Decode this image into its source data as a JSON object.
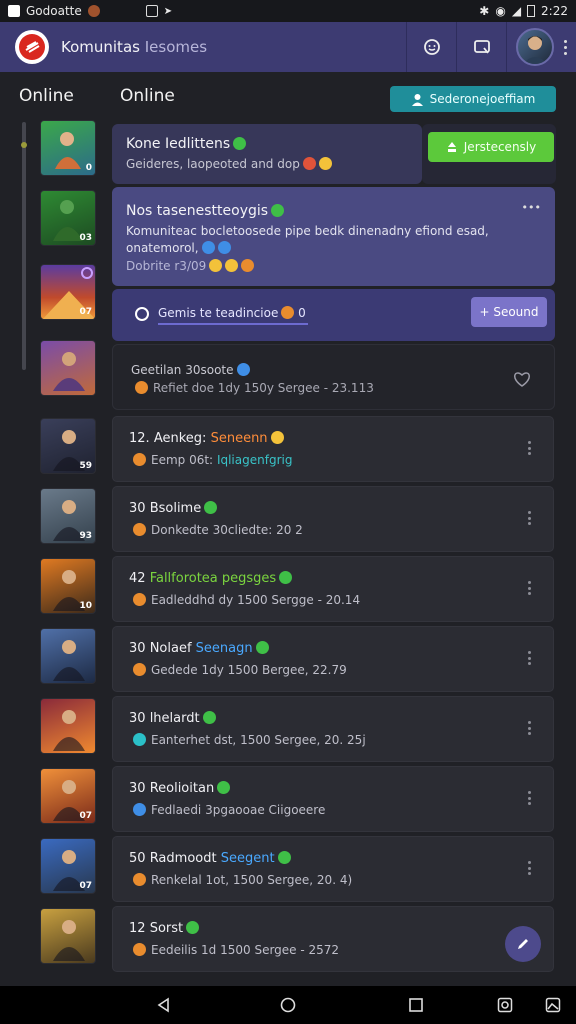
{
  "status_bar": {
    "app_name": "Godoatte",
    "time": "2:22"
  },
  "header": {
    "title": "Komunitas",
    "title_dim": "Iesomes"
  },
  "sections": {
    "left": "Online",
    "right": "Online"
  },
  "top_button": {
    "label": "Sederonejoeffiam"
  },
  "featured": [
    {
      "title": "Kone Iedlittens",
      "subtitle": "Geideres, laopeoted and dop",
      "action": "Jerstecensly"
    },
    {
      "title": "Nos tasenestteoygis",
      "body": "Komuniteac bocletoosede pipe bedk dinenadny efiond esad, onatemorol,",
      "meta": "Dobrite r3/09",
      "more": "•••"
    },
    {
      "input": "Gemis te teadincioe",
      "input_tail": "0",
      "button": "+ Seound"
    },
    {
      "title": "Geetilan 30soote",
      "subtitle": "Refiet doe 1dy 150y Sergee - 23.113"
    }
  ],
  "rows": [
    {
      "num": "12.",
      "name": "Aenkeg:",
      "highlight": "Seneenn",
      "highlight_color": "orange",
      "sub": "Eemp 06t:",
      "sub_highlight": "Iqliagenfgrig",
      "thumb_badge": "59"
    },
    {
      "num": "30",
      "name": "Bsolime",
      "highlight": "",
      "sub": "Donkedte 30cliedte: 20 2",
      "sub_highlight": "",
      "thumb_badge": "93"
    },
    {
      "num": "42",
      "name": "",
      "highlight": "Fallforotea pegsges",
      "highlight_color": "green",
      "sub": "Eadleddhd dy 1500 Sergge - 20.14",
      "sub_highlight": "",
      "thumb_badge": "10"
    },
    {
      "num": "30",
      "name": "Nolaef",
      "highlight": "Seenagn",
      "highlight_color": "blue",
      "sub": "Gedede 1dy 1500 Bergee, 22.79",
      "sub_highlight": "",
      "thumb_badge": ""
    },
    {
      "num": "30",
      "name": "lhelardt",
      "highlight": "",
      "sub": "Eanterhet dst, 1500 Sergee, 20. 25j",
      "sub_highlight": "",
      "thumb_badge": ""
    },
    {
      "num": "30",
      "name": "Reolioitan",
      "highlight": "",
      "sub": "Fedlaedi 3pgaooae Ciigoeere",
      "sub_highlight": "",
      "thumb_badge": "07"
    },
    {
      "num": "50",
      "name": "Radmoodt",
      "highlight": "Seegent",
      "highlight_color": "blue",
      "sub": "Renkelal 1ot, 1500 Sergee, 20. 4)",
      "sub_highlight": "",
      "thumb_badge": "07"
    },
    {
      "num": "12",
      "name": "Sorst",
      "highlight": "",
      "sub": "Eedeilis 1d 1500 Sergee - 2572",
      "sub_highlight": "",
      "thumb_badge": ""
    }
  ],
  "colors": {
    "appbar": "#3d3b72",
    "accent_teal": "#1f8e9a",
    "accent_green": "#5cc93b",
    "accent_purple": "#7b74c9"
  }
}
